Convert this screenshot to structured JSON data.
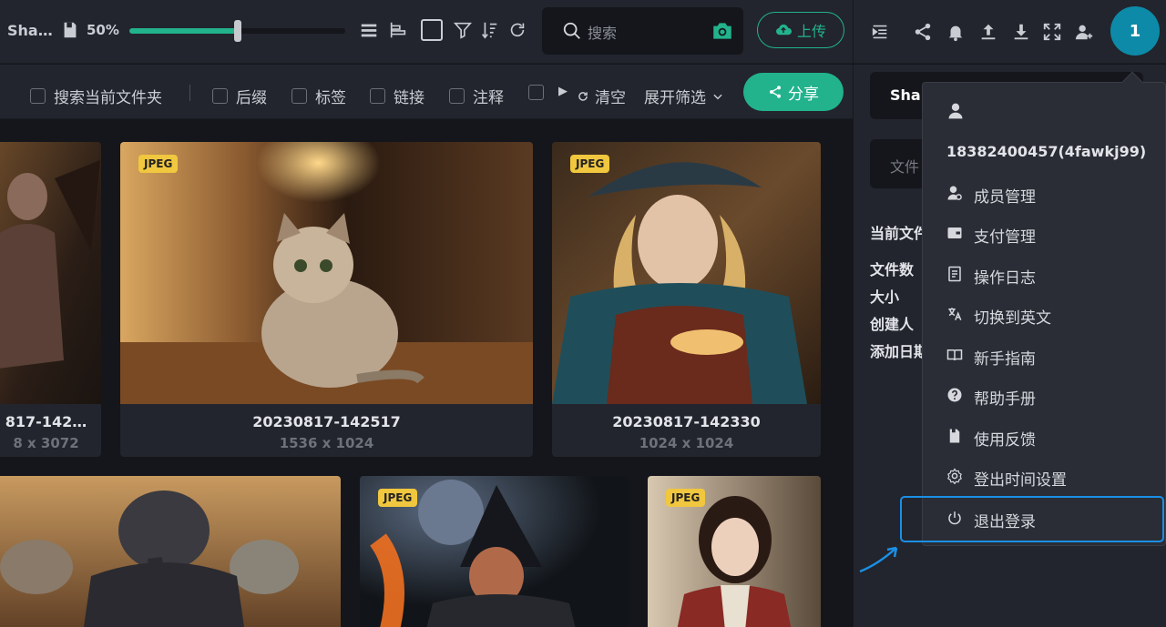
{
  "app": {
    "name": "Sha…"
  },
  "toolbar": {
    "zoom": "50%",
    "zoom_value": 50,
    "search_placeholder": "搜索",
    "upload_label": "上传"
  },
  "header": {
    "avatar_label": "1"
  },
  "filters": {
    "items": [
      {
        "label": "搜索当前文件夹"
      },
      {
        "label": "后缀"
      },
      {
        "label": "标签"
      },
      {
        "label": "链接"
      },
      {
        "label": "注释"
      },
      {
        "label": ""
      }
    ],
    "clear_label": "清空",
    "expand_label": "展开筛选",
    "share_label": "分享"
  },
  "gallery": {
    "cards": [
      {
        "name": "817-142…",
        "size": "8 x 3072",
        "badge": ""
      },
      {
        "name": "20230817-142517",
        "size": "1536 x 1024",
        "badge": "JPEG"
      },
      {
        "name": "20230817-142330",
        "size": "1024 x 1024",
        "badge": "JPEG"
      },
      {
        "badge": ""
      },
      {
        "badge": "JPEG"
      },
      {
        "badge": "JPEG"
      }
    ]
  },
  "panel": {
    "tab_label": "Shar",
    "field_placeholder": "文件",
    "section_title": "当前文件",
    "rows": [
      "文件数",
      "大小",
      "创建人",
      "添加日期"
    ]
  },
  "menu": {
    "username": "18382400457(4fawkj99)",
    "items": [
      {
        "label": "成员管理",
        "icon": "member-icon"
      },
      {
        "label": "支付管理",
        "icon": "wallet-icon"
      },
      {
        "label": "操作日志",
        "icon": "log-icon"
      },
      {
        "label": "切换到英文",
        "icon": "translate-icon"
      },
      {
        "label": "新手指南",
        "icon": "book-icon"
      },
      {
        "label": "帮助手册",
        "icon": "help-icon"
      },
      {
        "label": "使用反馈",
        "icon": "feedback-icon"
      },
      {
        "label": "登出时间设置",
        "icon": "settings-icon"
      },
      {
        "label": "退出登录",
        "icon": "power-icon"
      }
    ]
  },
  "colors": {
    "accent": "#22b38d",
    "highlight": "#1b8fe6",
    "badge": "#f0c73e"
  }
}
